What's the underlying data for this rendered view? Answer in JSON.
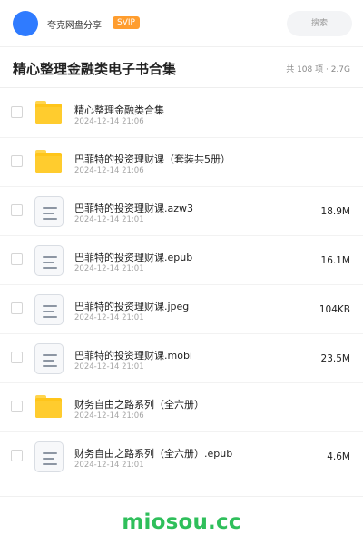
{
  "topbar": {
    "share_name": "夸克网盘分享",
    "badge": "SVIP",
    "search_label": "搜索"
  },
  "folder": {
    "title": "精心整理金融类电子书合集",
    "meta": "共 108 项 · 2.7G"
  },
  "items": [
    {
      "type": "folder",
      "name": "精心整理金融类合集",
      "date": "2024-12-14 21:06",
      "size": ""
    },
    {
      "type": "folder",
      "name": "巴菲特的投资理财课（套装共5册）",
      "date": "2024-12-14 21:06",
      "size": ""
    },
    {
      "type": "file",
      "name": "巴菲特的投资理财课.azw3",
      "date": "2024-12-14 21:01",
      "size": "18.9M"
    },
    {
      "type": "file",
      "name": "巴菲特的投资理财课.epub",
      "date": "2024-12-14 21:01",
      "size": "16.1M"
    },
    {
      "type": "file",
      "name": "巴菲特的投资理财课.jpeg",
      "date": "2024-12-14 21:01",
      "size": "104KB"
    },
    {
      "type": "file",
      "name": "巴菲特的投资理财课.mobi",
      "date": "2024-12-14 21:01",
      "size": "23.5M"
    },
    {
      "type": "folder",
      "name": "财务自由之路系列（全六册）",
      "date": "2024-12-14 21:06",
      "size": ""
    },
    {
      "type": "file",
      "name": "财务自由之路系列（全六册）.epub",
      "date": "2024-12-14 21:01",
      "size": "4.6M"
    }
  ],
  "watermark": "miosou.cc",
  "colors": {
    "accent_blue": "#2f7bff",
    "svip_orange": "#ff9d2e",
    "folder_yellow": "#ffc51a",
    "watermark_green": "#2fbf5b"
  },
  "icons": {
    "folder": "folder-icon",
    "file": "document-icon"
  }
}
